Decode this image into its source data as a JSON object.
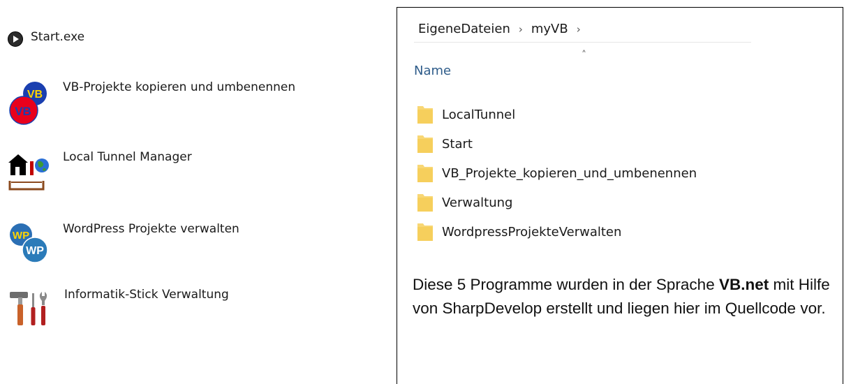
{
  "launcher": {
    "items": [
      {
        "label": "Start.exe",
        "icon": "play-icon"
      },
      {
        "label": "VB-Projekte kopieren und umbenennen",
        "icon": "vb-projects-icon"
      },
      {
        "label": "Local Tunnel Manager",
        "icon": "local-tunnel-icon"
      },
      {
        "label": "WordPress Projekte verwalten",
        "icon": "wordpress-icon"
      },
      {
        "label": "Informatik-Stick Verwaltung",
        "icon": "tools-icon"
      }
    ]
  },
  "explorer": {
    "breadcrumb": [
      "EigeneDateien",
      "myVB"
    ],
    "column_header": "Name",
    "folders": [
      "LocalTunnel",
      "Start",
      "VB_Projekte_kopieren_und_umbenennen",
      "Verwaltung",
      "WordpressProjekteVerwalten"
    ]
  },
  "description": {
    "part1": "Diese 5 Programme wurden in der Sprache ",
    "bold": "VB.net",
    "part2": " mit Hilfe von SharpDevelop erstellt und liegen hier im Quellcode vor."
  },
  "colors": {
    "folder": "#f8d775",
    "header_text": "#2e5c8a",
    "vb_red": "#e8001c",
    "vb_blue": "#1a3fb0",
    "wp_blue": "#2b7bb9"
  }
}
